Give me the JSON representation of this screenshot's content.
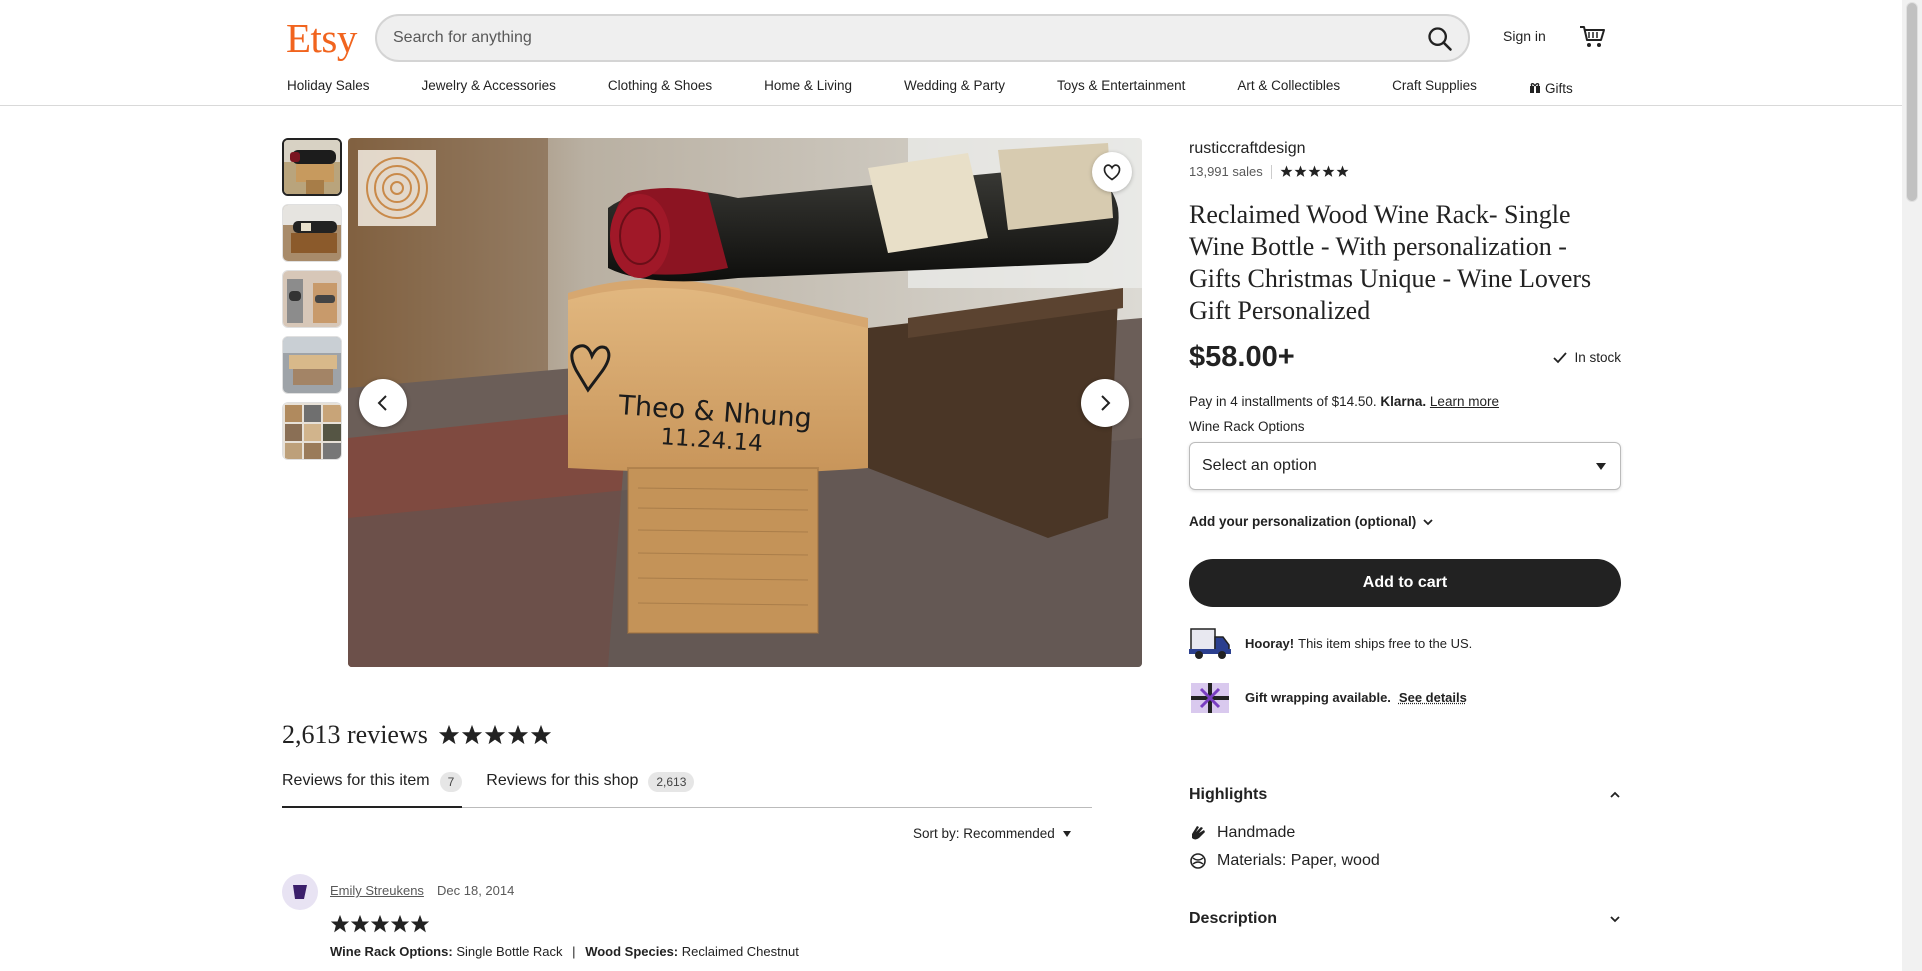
{
  "header": {
    "logo": "Etsy",
    "search_placeholder": "Search for anything",
    "sign_in": "Sign in",
    "categories": [
      "Holiday Sales",
      "Jewelry & Accessories",
      "Clothing & Shoes",
      "Home & Living",
      "Wedding & Party",
      "Toys & Entertainment",
      "Art & Collectibles",
      "Craft Supplies",
      "Gifts"
    ]
  },
  "listing": {
    "shop_name": "rusticcraftdesign",
    "sales": "13,991 sales",
    "shop_rating": 5,
    "title": "Reclaimed Wood Wine Rack- Single Wine Bottle - With personalization - Gifts Christmas Unique - Wine Lovers Gift Personalized",
    "price": "$58.00+",
    "stock": "In stock",
    "installments_prefix": "Pay in 4 installments of $14.50.",
    "klarna": "Klarna.",
    "learn_more": "Learn more",
    "option_label": "Wine Rack Options",
    "option_value": "Select an option",
    "personalization": "Add your personalization (optional)",
    "add_to_cart": "Add to cart",
    "shipping_bold": "Hooray!",
    "shipping_text": "This item ships free to the US.",
    "gift_text": "Gift wrapping available.",
    "gift_link": "See details",
    "image_engraving_line1": "Theo & Nhung",
    "image_engraving_line2": "11.24.14"
  },
  "highlights": {
    "heading": "Highlights",
    "items": [
      "Handmade",
      "Materials: Paper, wood"
    ]
  },
  "description_heading": "Description",
  "reviews": {
    "count_title": "2,613 reviews",
    "rating": 5,
    "tabs": [
      {
        "label": "Reviews for this item",
        "count": "7"
      },
      {
        "label": "Reviews for this shop",
        "count": "2,613"
      }
    ],
    "sort": "Sort by: Recommended",
    "first_review": {
      "name": "Emily Streukens",
      "date": "Dec 18, 2014",
      "stars": 5,
      "opt1_label": "Wine Rack Options:",
      "opt1_value": "Single Bottle Rack",
      "opt2_label": "Wood Species:",
      "opt2_value": "Reclaimed Chestnut"
    }
  },
  "colors": {
    "brand": "#f1641e",
    "text": "#222222",
    "button": "#222222"
  }
}
